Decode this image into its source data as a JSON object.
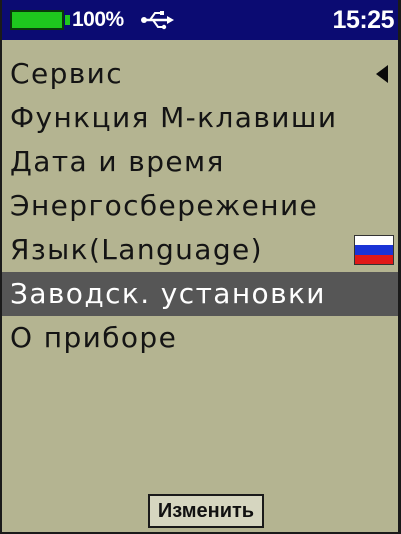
{
  "status_bar": {
    "battery_percent": "100%",
    "battery_level": 1.0,
    "usb_icon": "usb-icon",
    "time": "15:25",
    "colors": {
      "background": "#0b0b72",
      "battery_fill": "#1ec81e"
    }
  },
  "menu": {
    "items": [
      {
        "label": "Сервис",
        "icon": "arrow-left-icon"
      },
      {
        "label": "Функция М-клавиши"
      },
      {
        "label": "Дата и время"
      },
      {
        "label": "Энергосбережение"
      },
      {
        "label": "Язык(Language)",
        "icon": "russian-flag-icon"
      },
      {
        "label": "Заводск. установки",
        "selected": true
      },
      {
        "label": "О приборе"
      }
    ],
    "colors": {
      "background": "#b4b491",
      "selected_background": "#565656"
    }
  },
  "footer": {
    "change_button_label": "Изменить"
  }
}
